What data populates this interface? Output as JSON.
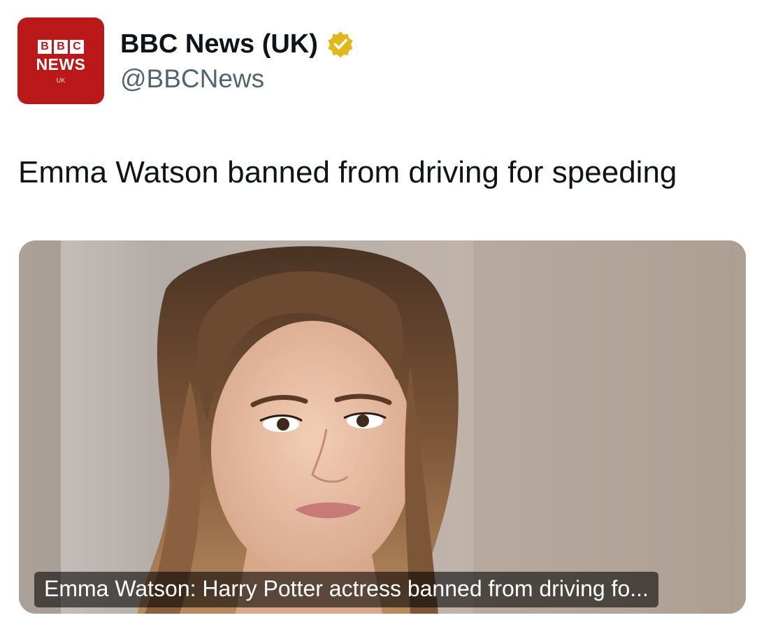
{
  "header": {
    "avatar": {
      "logo_letters": [
        "B",
        "B",
        "C"
      ],
      "logo_word": "NEWS",
      "logo_region": "UK",
      "brand_color": "#bb1919"
    },
    "display_name": "BBC News (UK)",
    "verified_icon": "verified-badge-icon",
    "verified_color": "#e2b719",
    "handle": "@BBCNews"
  },
  "tweet": {
    "text": "Emma Watson banned from driving for speeding"
  },
  "link_card": {
    "image_description_icon": "photo",
    "caption": "Emma Watson: Harry Potter actress banned from driving fo..."
  }
}
